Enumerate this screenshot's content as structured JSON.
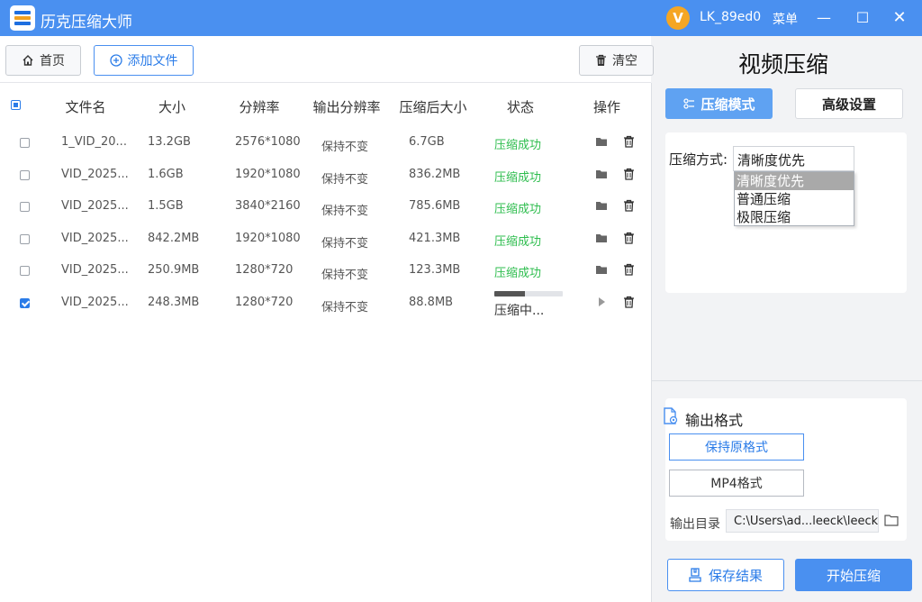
{
  "app": {
    "title": "历克压缩大师",
    "user_initial": "V",
    "user_name": "LK_89ed0",
    "menu_label": "菜单"
  },
  "window_controls": {
    "minimize": "—",
    "maximize": "☐",
    "close": "✕"
  },
  "toolbar": {
    "home_label": "首页",
    "add_label": "添加文件",
    "clear_label": "清空"
  },
  "table": {
    "headers": [
      "文件名",
      "大小",
      "分辨率",
      "输出分辨率",
      "压缩后大小",
      "状态",
      "操作"
    ],
    "rows": [
      {
        "checked": false,
        "name": "1_VID_20...",
        "size": "13.2GB",
        "resolution": "2576*1080",
        "output": "保持不变",
        "after": "6.7GB",
        "status": "压缩成功",
        "done": true
      },
      {
        "checked": false,
        "name": "VID_2025...",
        "size": "1.6GB",
        "resolution": "1920*1080",
        "output": "保持不变",
        "after": "836.2MB",
        "status": "压缩成功",
        "done": true
      },
      {
        "checked": false,
        "name": "VID_2025...",
        "size": "1.5GB",
        "resolution": "3840*2160",
        "output": "保持不变",
        "after": "785.6MB",
        "status": "压缩成功",
        "done": true
      },
      {
        "checked": false,
        "name": "VID_2025...",
        "size": "842.2MB",
        "resolution": "1920*1080",
        "output": "保持不变",
        "after": "421.3MB",
        "status": "压缩成功",
        "done": true
      },
      {
        "checked": false,
        "name": "VID_2025...",
        "size": "250.9MB",
        "resolution": "1280*720",
        "output": "保持不变",
        "after": "123.3MB",
        "status": "压缩成功",
        "done": true
      },
      {
        "checked": true,
        "name": "VID_2025...",
        "size": "248.3MB",
        "resolution": "1280*720",
        "output": "保持不变",
        "after": "88.8MB",
        "status": "压缩中...",
        "done": false,
        "progress": 0.45
      }
    ]
  },
  "right_panel": {
    "title": "视频压缩",
    "mode_compress": "压缩模式",
    "mode_advanced": "高级设置",
    "method_label": "压缩方式:",
    "method_value": "清晰度优先",
    "method_options": [
      "清晰度优先",
      "普通压缩",
      "极限压缩"
    ],
    "output_format_title": "输出格式",
    "format_keep": "保持原格式",
    "format_mp4": "MP4格式",
    "output_dir_label": "输出目录",
    "output_dir_value": "C:\\Users\\ad...leeck\\leeck",
    "save_label": "保存结果",
    "start_label": "开始压缩"
  },
  "colors": {
    "accent": "#4a90f0",
    "success": "#2ebd4e",
    "titlebar": "#4a90f0"
  }
}
